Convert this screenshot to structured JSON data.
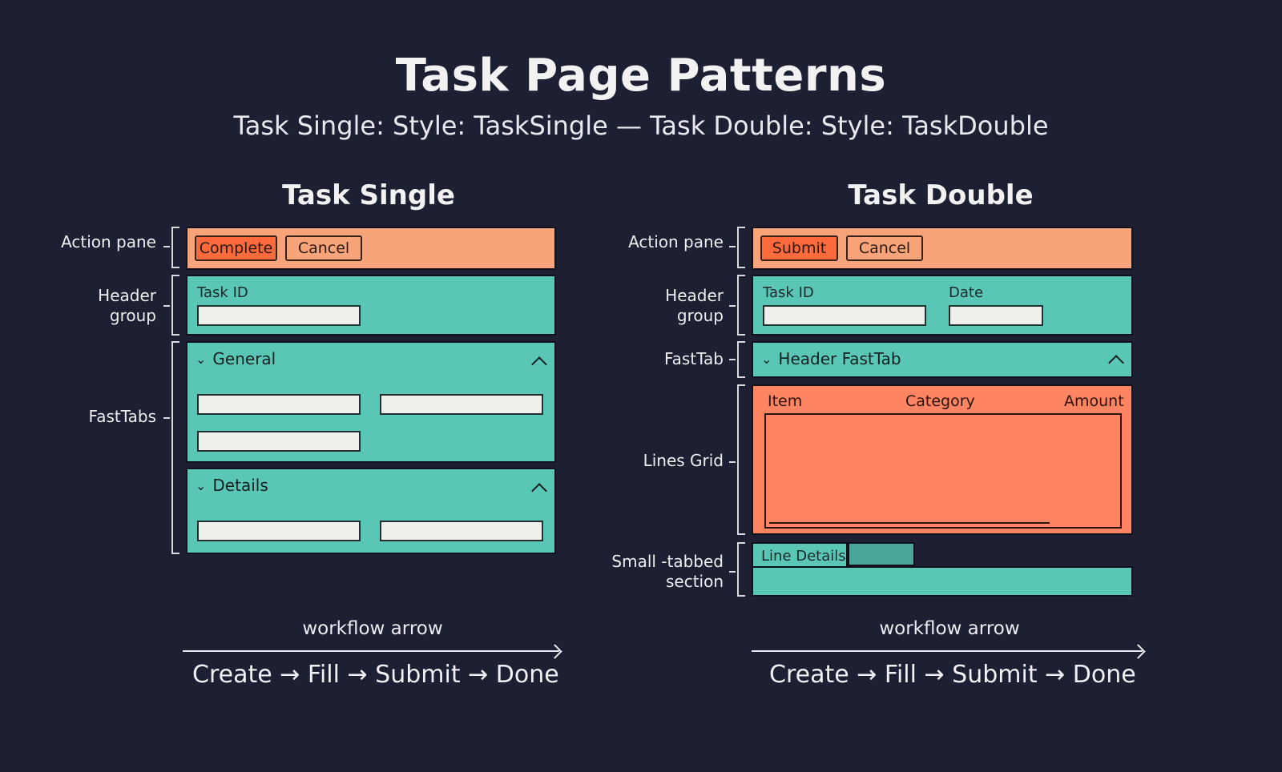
{
  "title": "Task Page Patterns",
  "subtitle": "Task Single: Style: TaskSingle — Task Double: Style: TaskDouble",
  "colors": {
    "background": "#1d1f33",
    "action_pane": "#f7a47a",
    "teal": "#5ac6b6",
    "coral": "#ff8461",
    "primary_button": "#ff6a3d"
  },
  "single": {
    "heading": "Task Single",
    "labels": {
      "action_pane": "Action pane",
      "header_group": "Header\ngroup",
      "fasttabs": "FastTabs"
    },
    "action_pane": {
      "primary": "Complete",
      "secondary": "Cancel"
    },
    "header_group": {
      "task_id_label": "Task ID"
    },
    "fasttabs": [
      {
        "title": "General",
        "chevron": "chevron-down-icon",
        "toggle": "chevron-up-icon"
      },
      {
        "title": "Details",
        "chevron": "chevron-down-icon",
        "toggle": "chevron-up-icon"
      }
    ],
    "workflow": {
      "label": "workflow arrow",
      "steps": "Create → Fill → Submit → Done"
    }
  },
  "double": {
    "heading": "Task Double",
    "labels": {
      "action_pane": "Action pane",
      "header_group": "Header\ngroup",
      "fasttab": "FastTab",
      "lines_grid": "Lines Grid",
      "small_tabbed": "Small -tabbed\nsection"
    },
    "action_pane": {
      "primary": "Submit",
      "secondary": "Cancel"
    },
    "header_group": {
      "task_id_label": "Task ID",
      "date_label": "Date"
    },
    "fasttab": {
      "title": "Header FastTab",
      "chevron": "chevron-down-icon",
      "toggle": "chevron-up-icon"
    },
    "grid": {
      "columns": [
        "Item",
        "Category",
        "Amount"
      ]
    },
    "small_tabbed": {
      "tab_label": "Line Details"
    },
    "workflow": {
      "label": "workflow arrow",
      "steps": "Create → Fill → Submit → Done"
    }
  }
}
